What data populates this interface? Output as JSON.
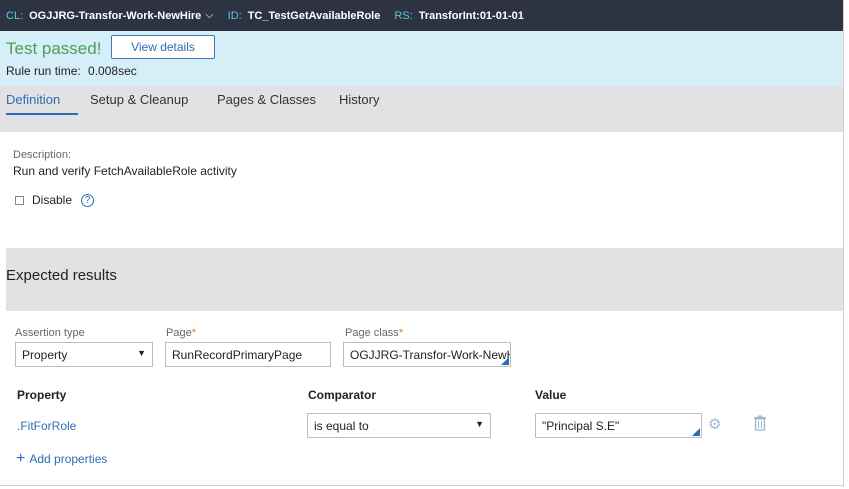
{
  "topbar": {
    "cl_key": "CL:",
    "cl_value": "OGJJRG-Transfor-Work-NewHire",
    "id_key": "ID:",
    "id_value": "TC_TestGetAvailableRole",
    "rs_key": "RS:",
    "rs_value": "TransforInt:01-01-01"
  },
  "banner": {
    "status": "Test passed!",
    "view_details": "View details",
    "runtime_label": "Rule run time:",
    "runtime_value": "0.008sec"
  },
  "tabs": [
    "Definition",
    "Setup & Cleanup",
    "Pages & Classes",
    "History"
  ],
  "definition": {
    "description_label": "Description:",
    "description_text": "Run and verify FetchAvailableRole activity",
    "disable_label": "Disable",
    "help_icon": "?"
  },
  "expected": {
    "title": "Expected results",
    "assertion_type_label": "Assertion type",
    "assertion_type_value": "Property",
    "page_label": "Page",
    "page_value": "RunRecordPrimaryPage",
    "page_class_label": "Page class",
    "page_class_value": "OGJJRG-Transfor-Work-NewHire",
    "required_mark": "*",
    "col_property": "Property",
    "col_comparator": "Comparator",
    "col_value": "Value",
    "row": {
      "property": ".FitForRole",
      "comparator": "is equal to",
      "value": "\"Principal S.E\""
    },
    "add_properties": "Add properties"
  },
  "colors": {
    "topbar_bg": "#2d3340",
    "banner_bg": "#d6eef8",
    "passed_green": "#4c9f54",
    "link_blue": "#2d6db5",
    "required_orange": "#e07a1a"
  }
}
